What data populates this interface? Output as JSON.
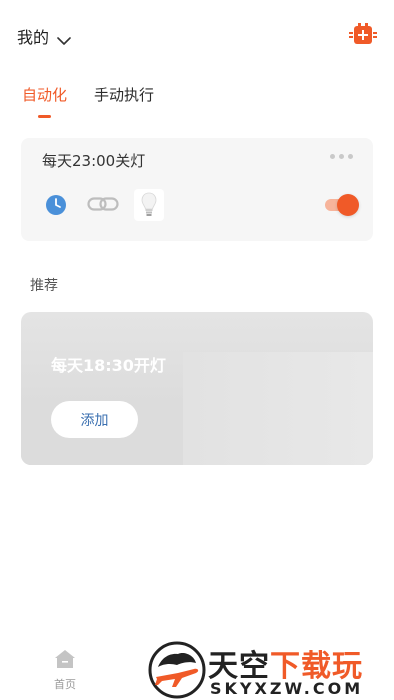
{
  "header": {
    "home_label": "我的",
    "icons": {
      "dropdown": "chevron-down-icon",
      "add": "add-device-icon"
    }
  },
  "tabs": [
    {
      "label": "自动化",
      "active": true
    },
    {
      "label": "手动执行",
      "active": false
    }
  ],
  "automation": {
    "title": "每天23:00关灯",
    "enabled": true,
    "icons": [
      "clock-icon",
      "link-icon",
      "light-bulb-icon"
    ]
  },
  "recommend": {
    "label": "推荐",
    "card_title": "每天18:30开灯",
    "add_label": "添加"
  },
  "bottom_nav": {
    "home_label": "首页"
  },
  "watermark": {
    "brand_part1": "天空",
    "brand_part2": "下载玩",
    "url": "SKYXZW.COM"
  },
  "colors": {
    "accent": "#f05a28",
    "card_bg": "#f6f6f6",
    "toggle_track": "#f7b49b",
    "clock_blue": "#4a90d9",
    "add_text": "#3a6fb0"
  }
}
